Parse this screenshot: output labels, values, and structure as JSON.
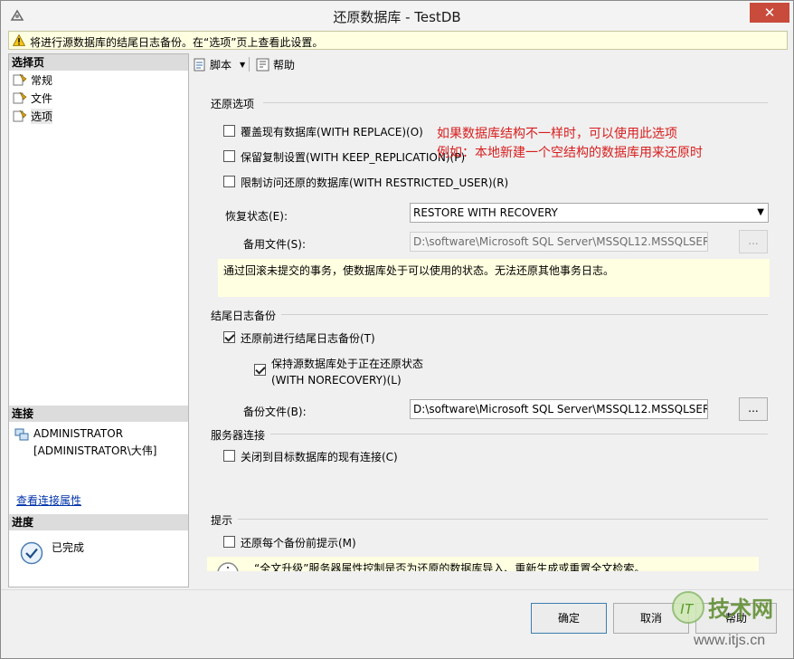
{
  "window": {
    "title": "还原数据库 - TestDB",
    "close_glyph": "✕"
  },
  "warning": {
    "text": "将进行源数据库的结尾日志备份。在“选项”页上查看此设置。"
  },
  "left": {
    "select_page_header": "选择页",
    "pages": [
      {
        "label": "常规"
      },
      {
        "label": "文件"
      },
      {
        "label": "选项"
      }
    ],
    "selected_page": "选项",
    "connection_header": "连接",
    "connection_server": "ADMINISTRATOR",
    "connection_user": "[ADMINISTRATOR\\大伟]",
    "view_connection_link": "查看连接属性",
    "progress_header": "进度",
    "progress_status": "已完成"
  },
  "toolbar": {
    "script_label": "脚本",
    "script_arrow": "▼",
    "help_label": "帮助"
  },
  "restore_options": {
    "title": "还原选项",
    "with_replace": {
      "label": "覆盖现有数据库(WITH REPLACE)(O)",
      "checked": false
    },
    "keep_replication": {
      "label": "保留复制设置(WITH KEEP_REPLICATION)(P)",
      "checked": false
    },
    "restricted_user": {
      "label": "限制访问还原的数据库(WITH RESTRICTED_USER)(R)",
      "checked": false
    },
    "recovery_state_label": "恢复状态(E):",
    "recovery_state_value": "RESTORE WITH RECOVERY",
    "standby_file_label": "备用文件(S):",
    "standby_file_value": "D:\\software\\Microsoft SQL Server\\MSSQL12.MSSQLSER",
    "browse_label": "...",
    "info_text": "通过回滚未提交的事务，使数据库处于可以使用的状态。无法还原其他事务日志。"
  },
  "annotation": {
    "line1": "如果数据库结构不一样时，可以使用此选项",
    "line2": "例如：本地新建一个空结构的数据库用来还原时"
  },
  "tail_log": {
    "title": "结尾日志备份",
    "take_tail_log": {
      "label": "还原前进行结尾日志备份(T)",
      "checked": true
    },
    "leave_restoring": {
      "label_line1": "保持源数据库处于正在还原状态",
      "label_line2": "(WITH NORECOVERY)(L)",
      "checked": true
    },
    "backup_file_label": "备份文件(B):",
    "backup_file_value": "D:\\software\\Microsoft SQL Server\\MSSQL12.MSSQLSER",
    "browse_label": "..."
  },
  "server_connections": {
    "title": "服务器连接",
    "close_connections": {
      "label": "关闭到目标数据库的现有连接(C)",
      "checked": false
    }
  },
  "prompt": {
    "title": "提示",
    "prompt_before": {
      "label": "还原每个备份前提示(M)",
      "checked": false
    },
    "info_text": "“全文升级”服务器属性控制是否为还原的数据库导入、重新生成或重置全文检索。"
  },
  "buttons": {
    "ok": "确定",
    "cancel": "取消",
    "help": "帮助"
  },
  "watermark": {
    "text": "技术网",
    "url": "www.itjs.cn"
  }
}
